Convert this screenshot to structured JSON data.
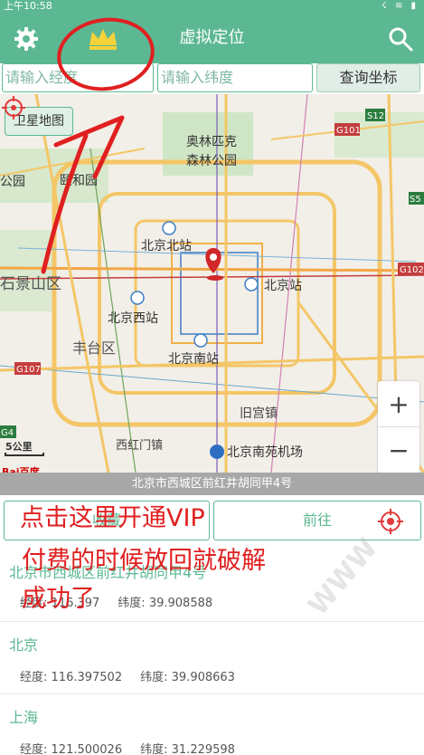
{
  "status_bar": {
    "time": "上午10:58",
    "icons": "☇ ≋ ▮"
  },
  "app_bar": {
    "title": "虚拟定位"
  },
  "search": {
    "longitude_placeholder": "请输入经度",
    "latitude_placeholder": "请输入纬度",
    "query_label": "查询坐标"
  },
  "map": {
    "satellite_label": "卫星地图",
    "labels": {
      "olympic_park": "奥林匹克森林公园",
      "olympic_park_l1": "奥林匹克",
      "olympic_park_l2": "森林公园",
      "yiheyuan": "颐和园",
      "park_left": "公园",
      "shijingshan": "石景山区",
      "beijing_north": "北京北站",
      "beijing_station": "北京站",
      "beijing_west": "北京西站",
      "fengtai": "丰台区",
      "beijing_south": "北京南站",
      "jiugong": "旧宫镇",
      "xihongmen": "西红门镇",
      "nanyuan_airport": "北京南苑机场",
      "s12": "S12",
      "g101": "G101",
      "g102": "G102",
      "g107": "G107",
      "g4": "G4",
      "s5": "S5"
    },
    "zoom_in": "+",
    "zoom_out": "−",
    "scale": "5公里",
    "logo": "Bai百度"
  },
  "address": "北京市西城区前红井胡同甲4号",
  "actions": {
    "favorite_label": "收藏",
    "go_label": "前往"
  },
  "annotation": {
    "line1": "点击这里开通VIP",
    "line2": "付费的时候放回就破解",
    "line3": "成功了"
  },
  "list": [
    {
      "name": "北京市西城区前红井胡同甲4号",
      "lng_label": "经度:",
      "lng": "116.397",
      "lat_label": "纬度:",
      "lat": "39.908588"
    },
    {
      "name": "北京",
      "lng_label": "经度:",
      "lng": "116.397502",
      "lat_label": "纬度:",
      "lat": "39.908663"
    },
    {
      "name": "上海",
      "lng_label": "经度:",
      "lng": "121.500026",
      "lat_label": "纬度:",
      "lat": "31.229598"
    }
  ],
  "watermark": "WWW",
  "colors": {
    "accent": "#5cb892",
    "annotation": "#e02020"
  }
}
